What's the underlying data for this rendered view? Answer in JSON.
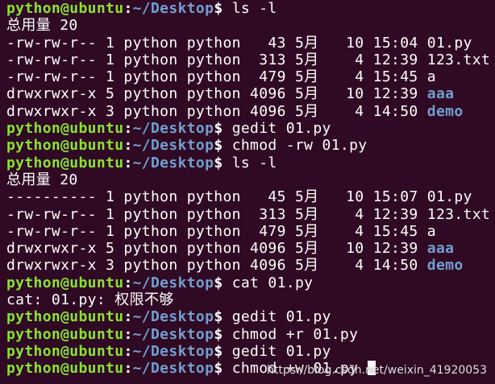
{
  "prompt": {
    "user": "python@ubuntu",
    "colon": ":",
    "path": "~/Desktop",
    "symbol": "$ "
  },
  "lines": [
    {
      "type": "prompt",
      "cmd": "ls -l"
    },
    {
      "type": "text",
      "text": "总用量 20"
    },
    {
      "type": "entry",
      "meta": "-rw-rw-r-- 1 python python   43 5月   10 15:04 ",
      "name": "01.py",
      "isDir": false
    },
    {
      "type": "entry",
      "meta": "-rw-rw-r-- 1 python python  313 5月    4 12:39 ",
      "name": "123.txt",
      "isDir": false
    },
    {
      "type": "entry",
      "meta": "-rw-rw-r-- 1 python python  479 5月    4 15:45 ",
      "name": "a",
      "isDir": false
    },
    {
      "type": "entry",
      "meta": "drwxrwxr-x 5 python python 4096 5月   10 12:39 ",
      "name": "aaa",
      "isDir": true
    },
    {
      "type": "entry",
      "meta": "drwxrwxr-x 3 python python 4096 5月    4 14:50 ",
      "name": "demo",
      "isDir": true
    },
    {
      "type": "prompt",
      "cmd": "gedit 01.py"
    },
    {
      "type": "prompt",
      "cmd": "chmod -rw 01.py"
    },
    {
      "type": "prompt",
      "cmd": "ls -l"
    },
    {
      "type": "text",
      "text": "总用量 20"
    },
    {
      "type": "entry",
      "meta": "---------- 1 python python   45 5月   10 15:07 ",
      "name": "01.py",
      "isDir": false
    },
    {
      "type": "entry",
      "meta": "-rw-rw-r-- 1 python python  313 5月    4 12:39 ",
      "name": "123.txt",
      "isDir": false
    },
    {
      "type": "entry",
      "meta": "-rw-rw-r-- 1 python python  479 5月    4 15:45 ",
      "name": "a",
      "isDir": false
    },
    {
      "type": "entry",
      "meta": "drwxrwxr-x 5 python python 4096 5月   10 12:39 ",
      "name": "aaa",
      "isDir": true
    },
    {
      "type": "entry",
      "meta": "drwxrwxr-x 3 python python 4096 5月    4 14:50 ",
      "name": "demo",
      "isDir": true
    },
    {
      "type": "prompt",
      "cmd": "cat 01.py"
    },
    {
      "type": "text",
      "text": "cat: 01.py: 权限不够"
    },
    {
      "type": "prompt",
      "cmd": "gedit 01.py"
    },
    {
      "type": "prompt",
      "cmd": "chmod +r 01.py"
    },
    {
      "type": "prompt",
      "cmd": "gedit 01.py"
    },
    {
      "type": "prompt",
      "cmd": "chmod +w 01.py ",
      "cursor": true
    }
  ],
  "watermark": "https://blog.csdn.net/weixin_41920053",
  "colors": {
    "background": "#300a24",
    "prompt_user": "#8ae234",
    "prompt_path": "#729fcf",
    "directory": "#729fcf",
    "text": "#ffffff"
  }
}
